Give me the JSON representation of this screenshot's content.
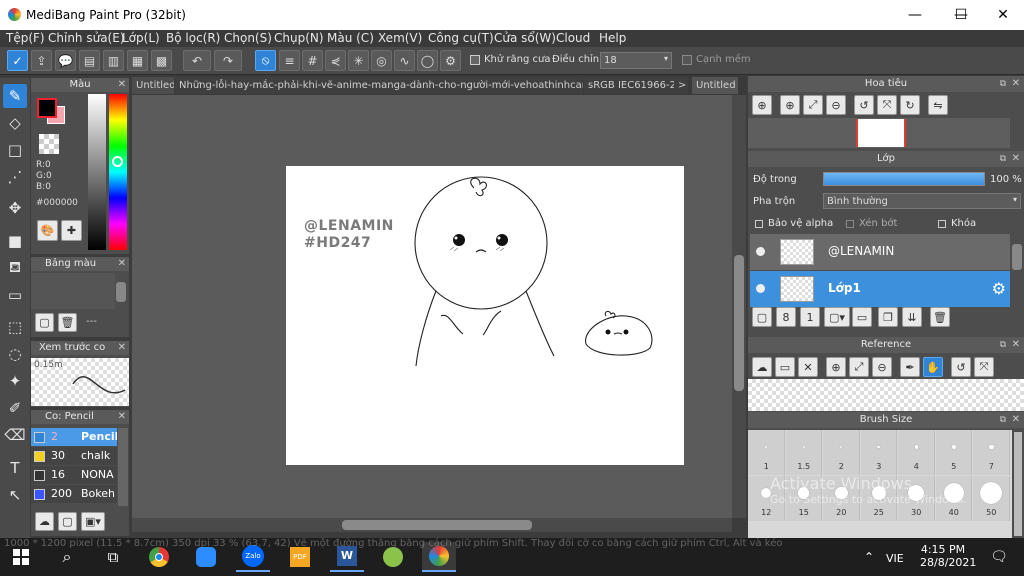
{
  "window": {
    "title": "MediBang Paint Pro (32bit)",
    "minimize": "—",
    "maximize": "☐",
    "close": "✕"
  },
  "menu": [
    "Tệp(F)",
    "Chỉnh sửa(E)",
    "Lớp(L)",
    "Bộ lọc(R)",
    "Chọn(S)",
    "Chụp(N)",
    "Màu (C)",
    "Xem(V)",
    "Công cụ(T)",
    "Cửa sổ(W)",
    "Cloud",
    "Help"
  ],
  "toolbar": {
    "antialias_label": "Khử răng cưa",
    "correction_label": "Điều chỉnh",
    "correction_value": "18",
    "edge_label": "Cạnh mềm"
  },
  "tabs": [
    "Untitled",
    "Những-lỗi-hay-mắc-phải-khi-vẽ-anime-manga-dành-cho-người-mới-vehoathinhcartoon-com.jpg",
    "sRGB IEC61966-2.1",
    ">",
    "Untitled"
  ],
  "color_panel": {
    "title": "Màu",
    "r": "R:0",
    "g": "G:0",
    "b": "B:0",
    "hex": "#000000",
    "primary_color": "#000000",
    "secondary_color": "#f4a6b0"
  },
  "palette_panel": {
    "title": "Bảng màu",
    "dashes": "---"
  },
  "preview_panel": {
    "title": "Xem trước co",
    "size": "0.15m"
  },
  "brush_panel": {
    "title": "Co: Pencil",
    "items": [
      {
        "size": "2",
        "name": "Pencil",
        "color": "#2f84d8",
        "selected": true
      },
      {
        "size": "30",
        "name": "chalk",
        "color": "#f5d020",
        "selected": false
      },
      {
        "size": "16",
        "name": "NONA",
        "color": "#333333",
        "selected": false
      },
      {
        "size": "200",
        "name": "Bokeh",
        "color": "#3b55ff",
        "selected": false
      }
    ]
  },
  "canvas_text": {
    "line1": "@LENAMIN",
    "line2": "#HD247"
  },
  "navigator": {
    "title": "Hoa tiêu"
  },
  "layer_panel": {
    "title": "Lớp",
    "opacity_label": "Độ trong",
    "opacity_value": "100 %",
    "opacity": 1.0,
    "blend_label": "Pha trộn",
    "blend_value": "Bình thường",
    "protect_alpha": "Bảo vệ alpha",
    "clipping": "Xén bớt",
    "lock": "Khóa",
    "layers": [
      {
        "name": "@LENAMIN",
        "selected": false
      },
      {
        "name": "Lớp1",
        "selected": true
      }
    ]
  },
  "reference_panel": {
    "title": "Reference"
  },
  "brush_size_panel": {
    "title": "Brush Size",
    "row1": [
      "1",
      "1.5",
      "2",
      "3",
      "4",
      "5",
      "7"
    ],
    "row2": [
      "12",
      "15",
      "20",
      "25",
      "30",
      "40",
      "50"
    ]
  },
  "status_text": "1000 * 1200 pixel (11.5 * 8.7cm) 350 dpi 33 % (63.7, 42) Vẽ một đường thẳng bằng cách giữ phím Shift. Thay đổi cỡ co bằng cách giữ phím Ctrl, Alt và kéo",
  "watermark": {
    "line1": "Activate Windows",
    "line2": "Go to Settings to activate Windows."
  },
  "taskbar": {
    "lang": "VIE",
    "time": "4:15 PM",
    "date": "28/8/2021"
  }
}
